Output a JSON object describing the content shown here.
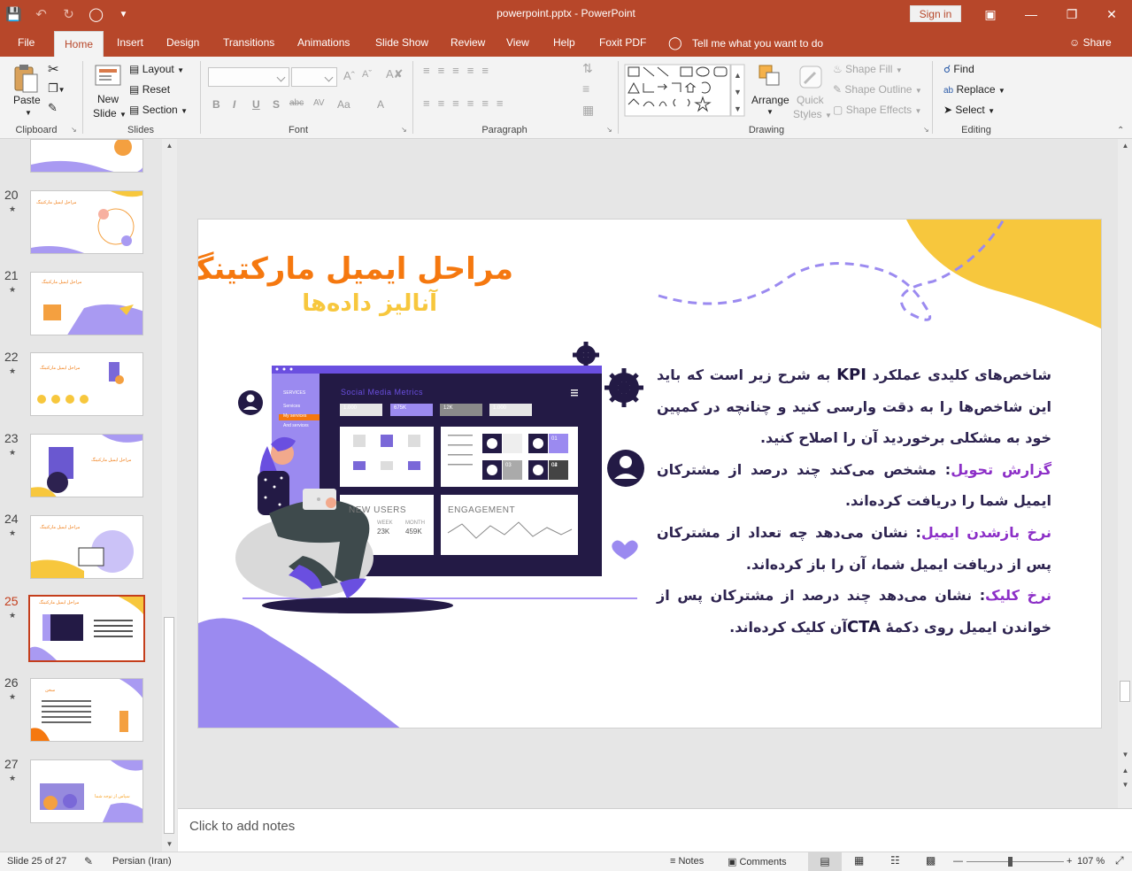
{
  "app": {
    "doc_title": "powerpoint.pptx  -  PowerPoint",
    "signin_label": "Sign in"
  },
  "tabs": [
    {
      "label": "File"
    },
    {
      "label": "Home"
    },
    {
      "label": "Insert"
    },
    {
      "label": "Design"
    },
    {
      "label": "Transitions"
    },
    {
      "label": "Animations"
    },
    {
      "label": "Slide Show"
    },
    {
      "label": "Review"
    },
    {
      "label": "View"
    },
    {
      "label": "Help"
    },
    {
      "label": "Foxit PDF"
    }
  ],
  "tell_me": "Tell me what you want to do",
  "share_label": "Share",
  "ribbon": {
    "clipboard": {
      "label": "Clipboard",
      "paste": "Paste"
    },
    "slides": {
      "label": "Slides",
      "new_slide_1": "New",
      "new_slide_2": "Slide",
      "layout": "Layout",
      "reset": "Reset",
      "section": "Section"
    },
    "font": {
      "label": "Font"
    },
    "paragraph": {
      "label": "Paragraph"
    },
    "drawing": {
      "label": "Drawing",
      "arrange": "Arrange",
      "quick_styles_1": "Quick",
      "quick_styles_2": "Styles",
      "shape_fill": "Shape Fill",
      "shape_outline": "Shape Outline",
      "shape_effects": "Shape Effects"
    },
    "editing": {
      "label": "Editing",
      "find": "Find",
      "replace": "Replace",
      "select": "Select"
    }
  },
  "thumbnails": [
    {
      "num": "20",
      "caption": "مراحل ایمیل مارکتینگ"
    },
    {
      "num": "21",
      "caption": "مراحل ایمیل مارکتینگ"
    },
    {
      "num": "22",
      "caption": "مراحل ایمیل مارکتینگ"
    },
    {
      "num": "23",
      "caption": "مراحل ایمیل مارکتینگ"
    },
    {
      "num": "24",
      "caption": "مراحل ایمیل مارکتینگ"
    },
    {
      "num": "25",
      "caption": "مراحل ایمیل مارکتینگ"
    },
    {
      "num": "26",
      "caption": "سخن"
    },
    {
      "num": "27",
      "caption": "سپاس از توجه شما"
    }
  ],
  "slide": {
    "title": "مراحل ایمیل مارکتینگ",
    "subtitle": "آنالیز داده‌ها",
    "dashboard": {
      "heading": "Social Media Metrics",
      "menu": [
        "SERVICES",
        "Services",
        "My services",
        "And services"
      ],
      "stats": [
        "1.000",
        "675K",
        "12K",
        "1.000"
      ],
      "new_users": "NEW USERS",
      "engagement": "ENGAGEMENT",
      "week": "WEEK",
      "week_val": "23K",
      "month": "MONTH",
      "month_val": "459K",
      "cards": [
        "01",
        "02",
        "03",
        "04"
      ]
    },
    "p1_a": "شاخص‌های کلیدی عملکرد ",
    "p1_kpi": "KPI",
    "p1_b": " به شرح زیر است که باید این شاخص‌ها را به دقت وارسی کنید و چنانچه در کمپین خود به مشکلی برخوردید آن را اصلاح کنید.",
    "p2_label": "گزارش تحویل",
    "p2_text": ": مشخص می‌کند چند درصد از مشترکان ایمیل شما را دریافت کرده‌اند.",
    "p3_label": "نرخ بازشدن ایمیل",
    "p3_text": ": نشان می‌دهد چه تعداد از مشترکان پس از دریافت ایمیل شما، آن را باز کرده‌اند.",
    "p4_label": "نرخ کلیک",
    "p4_text_a": ": نشان می‌دهد چند درصد از مشترکان پس از خواندن ایمیل روی دکمهٔ ",
    "p4_cta": "CTA",
    "p4_text_b": "آن کلیک کرده‌اند."
  },
  "notes_placeholder": "Click to add notes",
  "status": {
    "slide_info": "Slide 25 of 27",
    "language": "Persian (Iran)",
    "notes": "Notes",
    "comments": "Comments",
    "zoom": "107 %"
  },
  "colors": {
    "brand": "#b7472a",
    "orange": "#f5780f",
    "yellow": "#f7c73d",
    "purple": "#9b8af0",
    "navy": "#231a45"
  }
}
